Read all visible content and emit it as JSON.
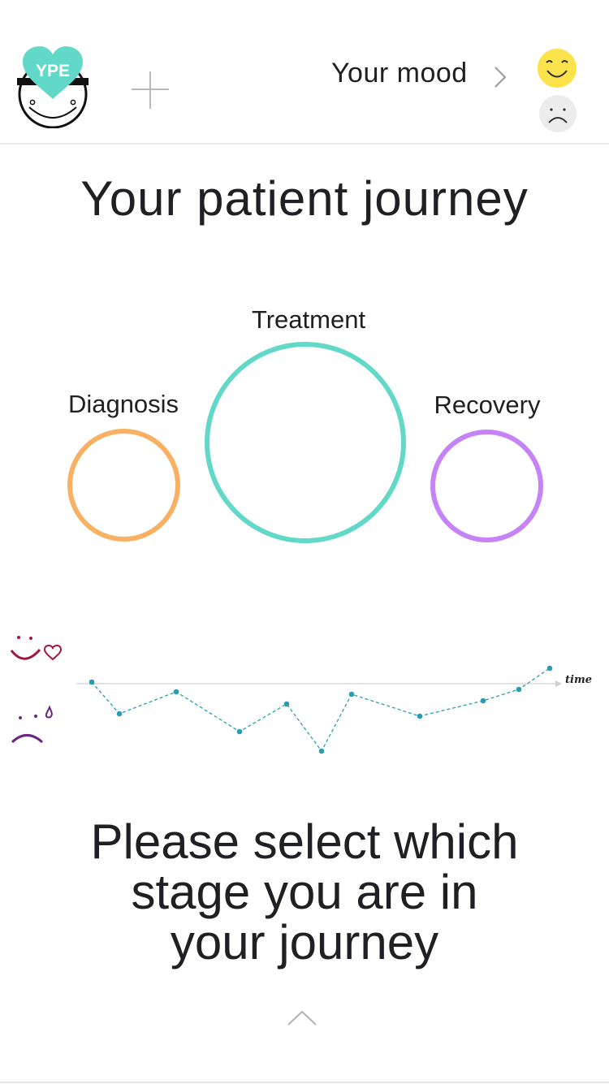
{
  "header": {
    "logo_text": "YPE",
    "add_icon": "plus-icon",
    "mood_label": "Your mood",
    "chevron_icon": "chevron-right-icon",
    "happy_icon": "happy-face-icon",
    "sad_icon": "sad-face-icon",
    "colors": {
      "logo_heart": "#62d8c8",
      "happy": "#fde34b",
      "sad": "#ececec"
    }
  },
  "title": "Your patient journey",
  "stages": [
    {
      "label": "Diagnosis",
      "color": "#f8b163"
    },
    {
      "label": "Treatment",
      "color": "#62d8c8"
    },
    {
      "label": "Recovery",
      "color": "#c583f7"
    }
  ],
  "mood_graph": {
    "axis_label": "time",
    "line_color": "#2a9db3",
    "happy_color": "#a3153e",
    "sad_color": "#6d2683"
  },
  "prompt_lines": [
    "Please select which",
    "stage you are in",
    "your journey"
  ],
  "footer": {
    "up_icon": "chevron-up-icon"
  }
}
